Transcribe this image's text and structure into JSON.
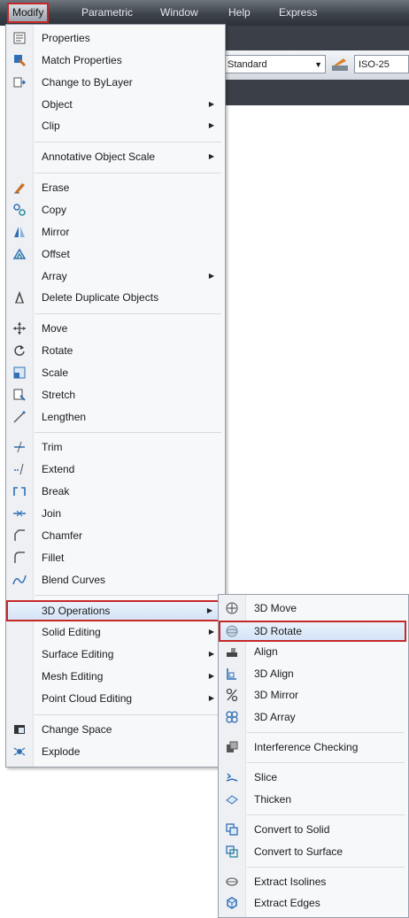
{
  "menubar": {
    "items": [
      {
        "label": "Modify",
        "active": true
      },
      {
        "label": "Parametric"
      },
      {
        "label": "Window"
      },
      {
        "label": "Help"
      },
      {
        "label": "Express"
      }
    ]
  },
  "toolbar": {
    "style_combo": "Standard",
    "dim_combo": "ISO-25"
  },
  "modify_menu": {
    "groups": [
      [
        {
          "label": "Properties",
          "icon": "properties-icon"
        },
        {
          "label": "Match Properties",
          "icon": "match-properties-icon"
        },
        {
          "label": "Change to ByLayer",
          "icon": "bylayer-icon"
        },
        {
          "label": "Object",
          "submenu": true
        },
        {
          "label": "Clip",
          "submenu": true
        }
      ],
      [
        {
          "label": "Annotative Object Scale",
          "submenu": true
        }
      ],
      [
        {
          "label": "Erase",
          "icon": "erase-icon"
        },
        {
          "label": "Copy",
          "icon": "copy-icon"
        },
        {
          "label": "Mirror",
          "icon": "mirror-icon"
        },
        {
          "label": "Offset",
          "icon": "offset-icon"
        },
        {
          "label": "Array",
          "submenu": true
        },
        {
          "label": "Delete Duplicate Objects",
          "icon": "delete-duplicate-icon"
        }
      ],
      [
        {
          "label": "Move",
          "icon": "move-icon"
        },
        {
          "label": "Rotate",
          "icon": "rotate-icon"
        },
        {
          "label": "Scale",
          "icon": "scale-icon"
        },
        {
          "label": "Stretch",
          "icon": "stretch-icon"
        },
        {
          "label": "Lengthen",
          "icon": "lengthen-icon"
        }
      ],
      [
        {
          "label": "Trim",
          "icon": "trim-icon"
        },
        {
          "label": "Extend",
          "icon": "extend-icon"
        },
        {
          "label": "Break",
          "icon": "break-icon"
        },
        {
          "label": "Join",
          "icon": "join-icon"
        },
        {
          "label": "Chamfer",
          "icon": "chamfer-icon"
        },
        {
          "label": "Fillet",
          "icon": "fillet-icon"
        },
        {
          "label": "Blend Curves",
          "icon": "blend-curves-icon"
        }
      ],
      [
        {
          "label": "3D Operations",
          "submenu": true,
          "highlighted": true
        },
        {
          "label": "Solid Editing",
          "submenu": true
        },
        {
          "label": "Surface Editing",
          "submenu": true
        },
        {
          "label": "Mesh Editing",
          "submenu": true
        },
        {
          "label": "Point Cloud Editing",
          "submenu": true
        }
      ],
      [
        {
          "label": "Change Space",
          "icon": "change-space-icon"
        },
        {
          "label": "Explode",
          "icon": "explode-icon"
        }
      ]
    ]
  },
  "operations_submenu": {
    "groups": [
      [
        {
          "label": "3D Move",
          "icon": "3d-move-icon"
        },
        {
          "label": "3D Rotate",
          "icon": "3d-rotate-icon",
          "highlighted": true
        },
        {
          "label": "Align",
          "icon": "align-icon"
        },
        {
          "label": "3D Align",
          "icon": "3d-align-icon"
        },
        {
          "label": "3D Mirror",
          "icon": "3d-mirror-icon"
        },
        {
          "label": "3D Array",
          "icon": "3d-array-icon"
        }
      ],
      [
        {
          "label": "Interference Checking",
          "icon": "interference-icon"
        }
      ],
      [
        {
          "label": "Slice",
          "icon": "slice-icon"
        },
        {
          "label": "Thicken",
          "icon": "thicken-icon"
        }
      ],
      [
        {
          "label": "Convert to Solid",
          "icon": "convert-solid-icon"
        },
        {
          "label": "Convert to Surface",
          "icon": "convert-surface-icon"
        }
      ],
      [
        {
          "label": "Extract Isolines",
          "icon": "extract-isolines-icon"
        },
        {
          "label": "Extract Edges",
          "icon": "extract-edges-icon"
        }
      ]
    ]
  },
  "colors": {
    "highlight_border": "#c62828",
    "icon_blue": "#2f6fb5",
    "icon_teal": "#2a8a9a"
  }
}
